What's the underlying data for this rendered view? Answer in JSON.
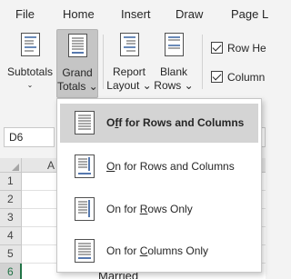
{
  "tabs": [
    "File",
    "Home",
    "Insert",
    "Draw",
    "Page L"
  ],
  "ribbon": {
    "subtotals": {
      "line1": "Subtotals",
      "line2": "⌄"
    },
    "grand_totals": {
      "line1": "Grand",
      "line2": "Totals ⌄"
    },
    "report_layout": {
      "line1": "Report",
      "line2": "Layout ⌄"
    },
    "blank_rows": {
      "line1": "Blank",
      "line2": "Rows ⌄"
    },
    "row_headers": "Row He",
    "column_headers": "Column"
  },
  "name_box": "D6",
  "column_header": "A",
  "row_numbers": [
    "1",
    "2",
    "3",
    "4",
    "5",
    "6"
  ],
  "partial_cell_text": "Married",
  "menu": {
    "items": [
      {
        "pre": "O",
        "key": "f",
        "post": "f for Rows and Columns",
        "highlighted": true
      },
      {
        "pre": "",
        "key": "O",
        "post": "n for Rows and Columns",
        "highlighted": false
      },
      {
        "pre": "On for ",
        "key": "R",
        "post": "ows Only",
        "highlighted": false
      },
      {
        "pre": "On for ",
        "key": "C",
        "post": "olumns Only",
        "highlighted": false
      }
    ]
  },
  "colors": {
    "accent": "#2b579a",
    "green": "#217346",
    "highlight": "#d4d4d4"
  }
}
